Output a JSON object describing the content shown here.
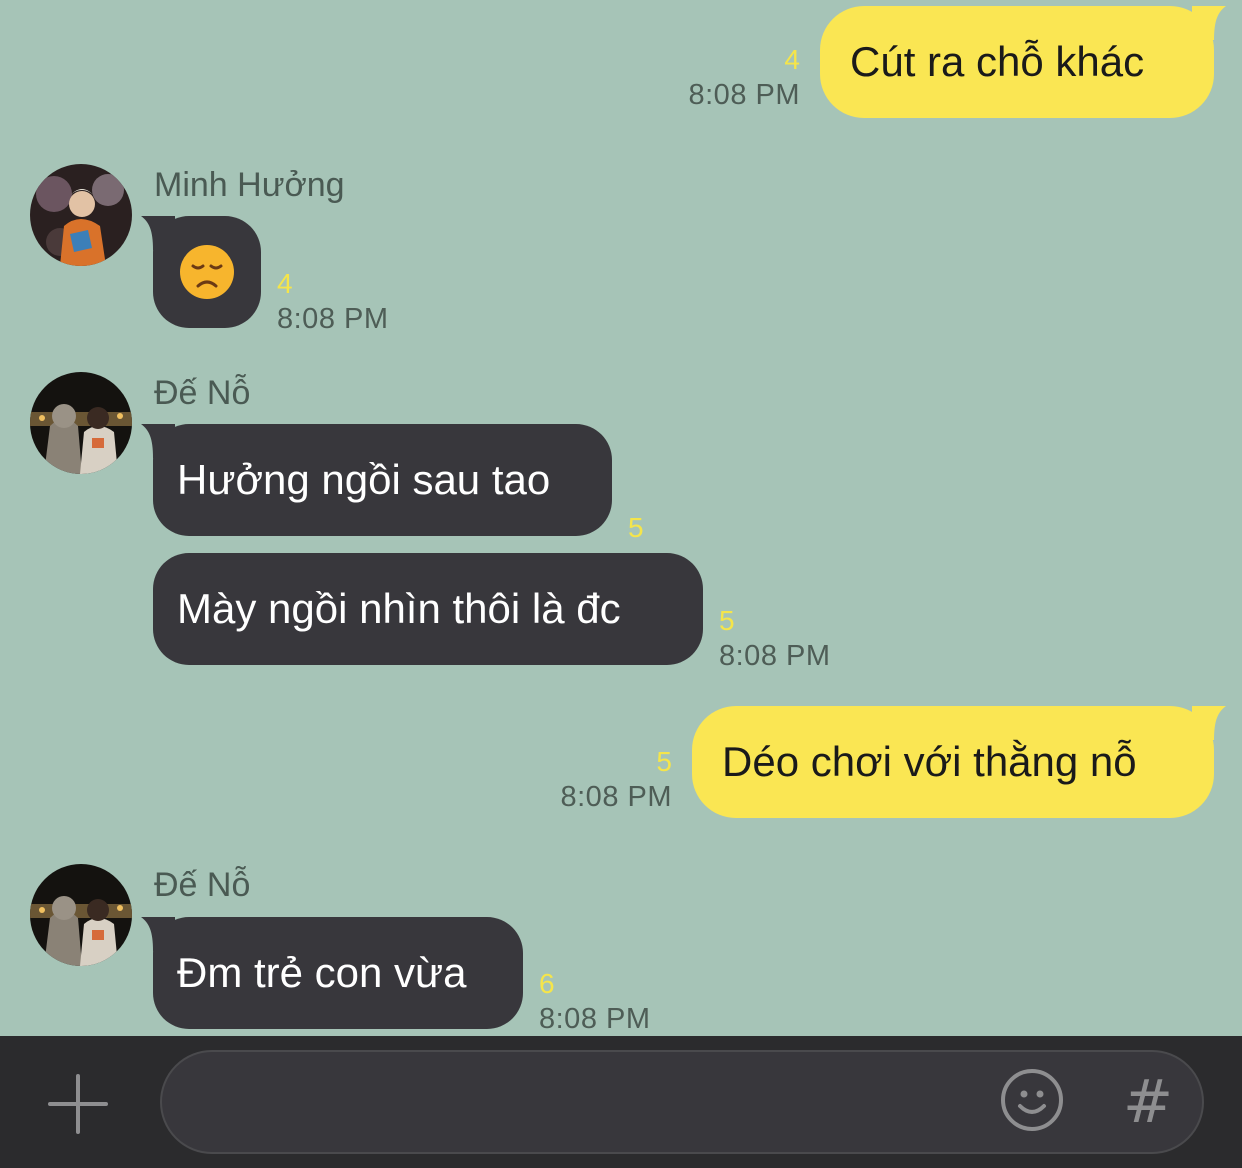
{
  "messages": [
    {
      "sender": "me",
      "text": "Cút ra chỗ khác",
      "unread": "4",
      "time": "8:08 PM"
    },
    {
      "sender": "Minh Hưởng",
      "avatar": "avatar-minh-huong",
      "emoji": "disappointed-face-emoji",
      "unread": "4",
      "time": "8:08 PM"
    },
    {
      "sender": "Đế Nỗ",
      "avatar": "avatar-de-no",
      "text": "Hưởng ngồi sau tao",
      "unread": "5"
    },
    {
      "sender": "Đế Nỗ",
      "text": "Mày ngồi nhìn thôi là đc",
      "unread": "5",
      "time": "8:08 PM"
    },
    {
      "sender": "me",
      "text": "Déo chơi với thằng nỗ",
      "unread": "5",
      "time": "8:08 PM"
    },
    {
      "sender": "Đế Nỗ",
      "avatar": "avatar-de-no",
      "text": "Đm trẻ con vừa",
      "unread": "6",
      "time": "8:08 PM"
    }
  ],
  "input_bar": {
    "placeholder": "",
    "icons": [
      "plus-icon",
      "emoji-icon",
      "hashtag-icon"
    ],
    "hash_symbol": "#"
  },
  "colors": {
    "background": "#a6c4b7",
    "my_bubble": "#fae653",
    "their_bubble": "#38373c",
    "unread_count": "#f5e54a",
    "input_bar": "#2b2b2d"
  }
}
